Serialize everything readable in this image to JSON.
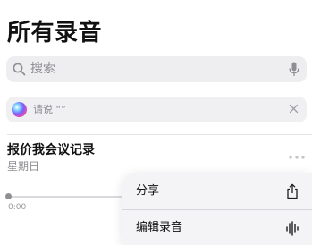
{
  "header": {
    "title": "所有录音"
  },
  "search": {
    "placeholder": "搜索",
    "leading_icon": "search-icon",
    "trailing_icon": "mic-icon"
  },
  "siri_suggestion": {
    "text": "请说 “”",
    "icon": "siri-icon",
    "close_icon": "close-icon"
  },
  "recording": {
    "title": "报价我会议记录",
    "date": "星期日",
    "current_time": "0:00",
    "more_icon": "more-icon"
  },
  "context_menu": {
    "items": [
      {
        "label": "分享",
        "icon": "share-icon"
      },
      {
        "label": "编辑录音",
        "icon": "waveform-icon"
      }
    ]
  },
  "colors": {
    "secondary_text": "#8e8e93",
    "search_background": "#eeeef0",
    "menu_background": "#f4f4f6"
  }
}
